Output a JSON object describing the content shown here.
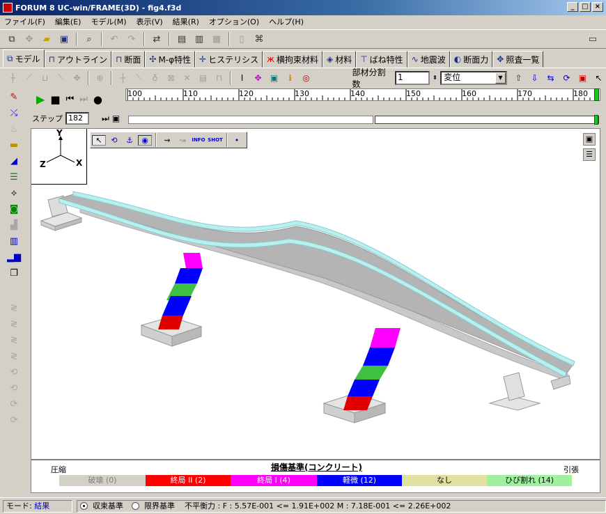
{
  "window": {
    "title": "FORUM 8   UC-win/FRAME(3D)  - fig4.f3d",
    "min": "_",
    "max": "□",
    "close": "×"
  },
  "menu": [
    "ファイル(F)",
    "編集(E)",
    "モデル(M)",
    "表示(V)",
    "結果(R)",
    "オプション(O)",
    "ヘルプ(H)"
  ],
  "tabs": [
    {
      "label": "モデル",
      "icon": "model-icon"
    },
    {
      "label": "アウトライン",
      "icon": "outline-icon"
    },
    {
      "label": "断面",
      "icon": "section-icon"
    },
    {
      "label": "M-φ特性",
      "icon": "m-phi-icon"
    },
    {
      "label": "ヒステリシス",
      "icon": "hysteresis-icon"
    },
    {
      "label": "横拘束材料",
      "icon": "confinement-icon"
    },
    {
      "label": "材料",
      "icon": "material-icon"
    },
    {
      "label": "ばね特性",
      "icon": "spring-icon"
    },
    {
      "label": "地震波",
      "icon": "wave-icon"
    },
    {
      "label": "断面力",
      "icon": "force-icon"
    },
    {
      "label": "照査一覧",
      "icon": "check-icon"
    }
  ],
  "toolbar2": {
    "division_label": "部材分割数",
    "division_value": "1",
    "display_value": "変位"
  },
  "playback": {
    "step_label": "ステップ",
    "step_value": "182"
  },
  "ruler": {
    "ticks": [
      "100",
      "110",
      "120",
      "130",
      "140",
      "150",
      "160",
      "170",
      "180"
    ]
  },
  "axes": {
    "y": "Y",
    "z": "Z",
    "x": "X"
  },
  "viewtools": [
    "INFO",
    "SHOT"
  ],
  "legend": {
    "title": "損傷基準(コンクリート)",
    "left": "圧縮",
    "right": "引張",
    "items": [
      {
        "label": "破壊 (0)",
        "color": "#d4d0c8",
        "text": "#808080"
      },
      {
        "label": "終局 II (2)",
        "color": "#ff0000",
        "text": "#ffffff"
      },
      {
        "label": "終局 I (4)",
        "color": "#ff00ff",
        "text": "#ffffff"
      },
      {
        "label": "軽微 (12)",
        "color": "#0000ff",
        "text": "#ffffff"
      },
      {
        "label": "なし",
        "color": "#e0e0a0",
        "text": "#000000"
      },
      {
        "label": "ひび割れ (14)",
        "color": "#a0f0a0",
        "text": "#000000"
      }
    ]
  },
  "status": {
    "mode_label": "モード:",
    "mode_value": "結果",
    "radio1": "収束基準",
    "radio2": "限界基準",
    "balance": "不平衡力 : F : 5.57E-001 <= 1.91E+002  M : 7.18E-001 <= 2.26E+002"
  }
}
